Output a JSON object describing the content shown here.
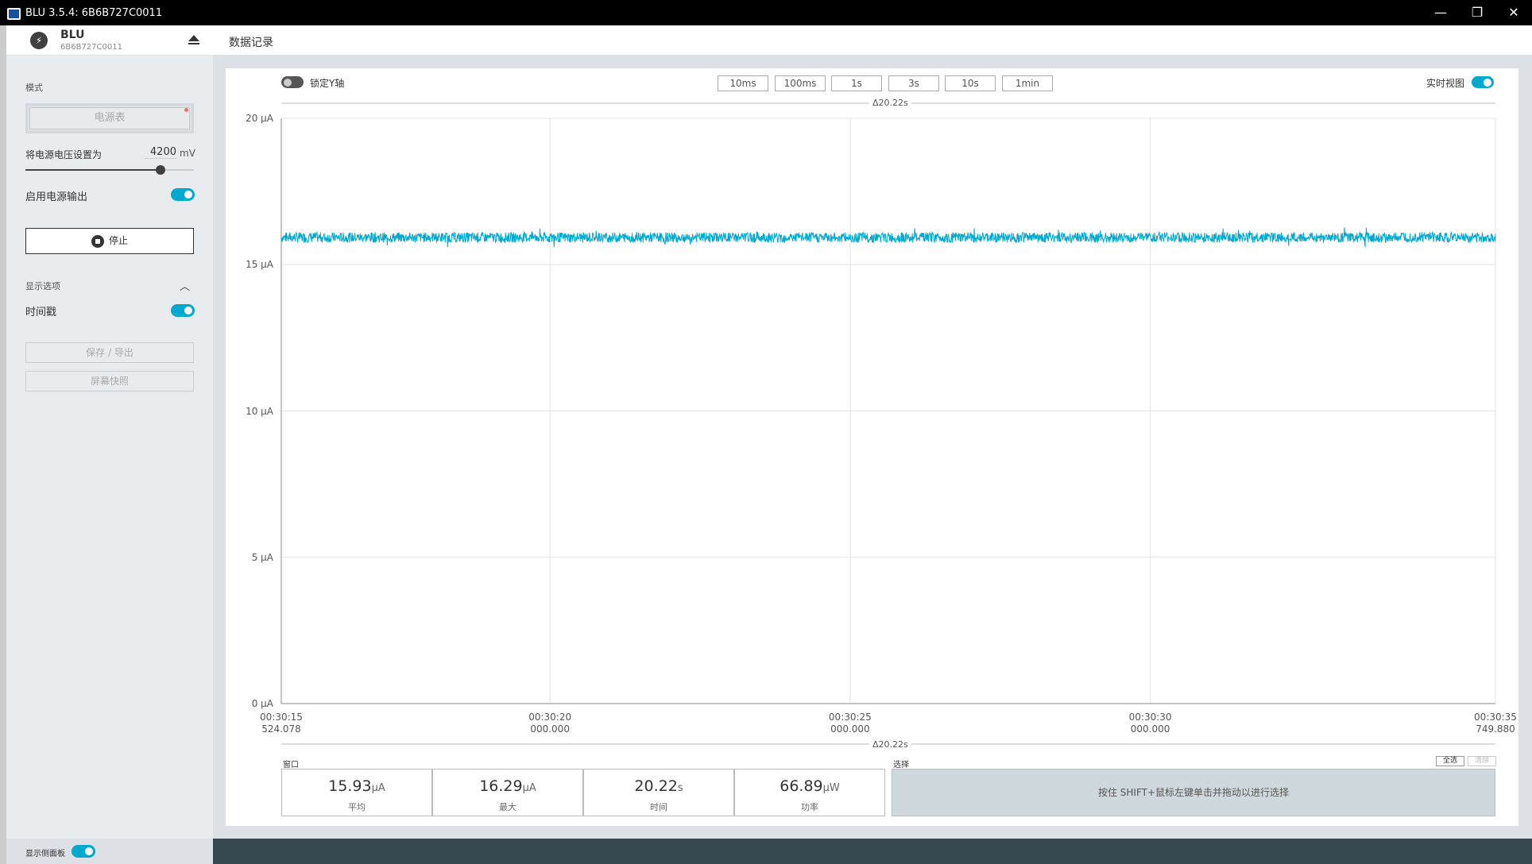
{
  "window": {
    "title": "BLU 3.5.4: 6B6B727C0011",
    "minimize_glyph": "—",
    "maximize_glyph": "❐",
    "close_glyph": "✕"
  },
  "device": {
    "name": "BLU",
    "serial": "6B6B727C0011",
    "icon": "lightning-icon",
    "icon_glyph": "⚡",
    "eject_icon": "eject-icon"
  },
  "sidebar": {
    "mode_label": "模式",
    "mode_button": "电源表",
    "voltage_label": "将电源电压设置为",
    "voltage_value": "4200",
    "voltage_unit": "mV",
    "voltage_slider_fraction": 0.8,
    "enable_output_label": "启用电源输出",
    "enable_output_on": true,
    "stop_button": "停止",
    "display_options_label": "显示选项",
    "display_options_chevron": "︿",
    "timestamp_label": "时间戳",
    "timestamp_on": true,
    "save_export_button": "保存 / 导出",
    "screenshot_button": "屏幕快照",
    "show_sidebar_label": "显示侧面板",
    "show_sidebar_on": true
  },
  "main": {
    "title": "数据记录",
    "lock_y_label": "锁定Y轴",
    "lock_y_on": false,
    "realtime_label": "实时视图",
    "realtime_on": true,
    "window_buttons": [
      "10ms",
      "100ms",
      "1s",
      "3s",
      "10s",
      "1min"
    ],
    "delta_top": "Δ20.22s",
    "delta_bottom": "Δ20.22s",
    "window_label": "窗口",
    "selection_label": "选择",
    "select_all_button": "全选",
    "clear_button": "清除",
    "selection_hint": "按住 SHIFT+鼠标左键单击并拖动以进行选择",
    "stats": [
      {
        "value": "15.93",
        "unit": "μA",
        "label": "平均"
      },
      {
        "value": "16.29",
        "unit": "μA",
        "label": "最大"
      },
      {
        "value": "20.22",
        "unit": "s",
        "label": "时间"
      },
      {
        "value": "66.89",
        "unit": "μW",
        "label": "功率"
      }
    ]
  },
  "chart_data": {
    "type": "line",
    "series_color": "#00a9ce",
    "ylim": [
      0,
      20
    ],
    "yticks": [
      "0 μA",
      "5 μA",
      "10 μA",
      "15 μA",
      "20 μA"
    ],
    "xticks": [
      {
        "time": "00:30:15",
        "ms": "524.078"
      },
      {
        "time": "00:30:20",
        "ms": "000.000"
      },
      {
        "time": "00:30:25",
        "ms": "000.000"
      },
      {
        "time": "00:30:30",
        "ms": "000.000"
      },
      {
        "time": "00:30:35",
        "ms": "749.880"
      }
    ],
    "x_range_s": [
      15.524,
      35.75
    ],
    "mean_uA": 15.93,
    "max_uA": 16.29,
    "noise_band_uA": [
      15.6,
      16.29
    ],
    "grid": true
  }
}
